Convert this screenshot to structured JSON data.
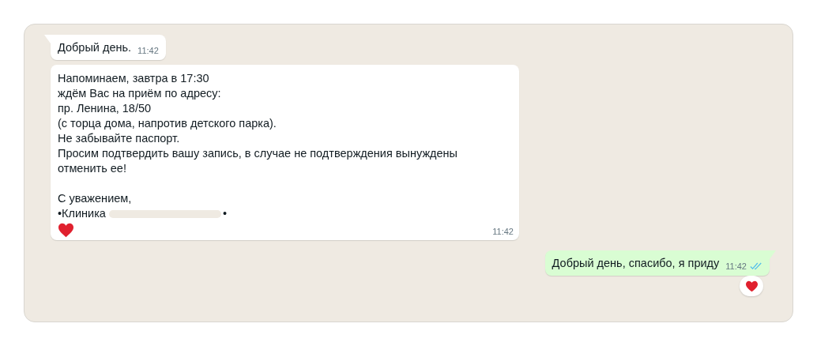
{
  "messages": [
    {
      "kind": "incoming",
      "tail": true,
      "text": "Добрый день.",
      "time": "11:42"
    },
    {
      "kind": "incoming",
      "tail": false,
      "text": "Напоминаем, завтра в 17:30\nждём Вас на приём по адресу:\nпр. Ленина, 18/50\n(с торца дома, напротив детского парка).\nНе забывайте паспорт.\nПросим подтвердить вашу запись, в случае не подтверждения вынуждены\nотменить ее!\n\nС уважением,",
      "signature": {
        "prefix": "•Клиника",
        "suffix": "•",
        "redacted": true
      },
      "trailing_heart": true,
      "time": "11:42"
    },
    {
      "kind": "outgoing",
      "tail": true,
      "text": "Добрый день, спасибо, я приду",
      "time": "11:42",
      "read": true,
      "reaction": true
    }
  ]
}
